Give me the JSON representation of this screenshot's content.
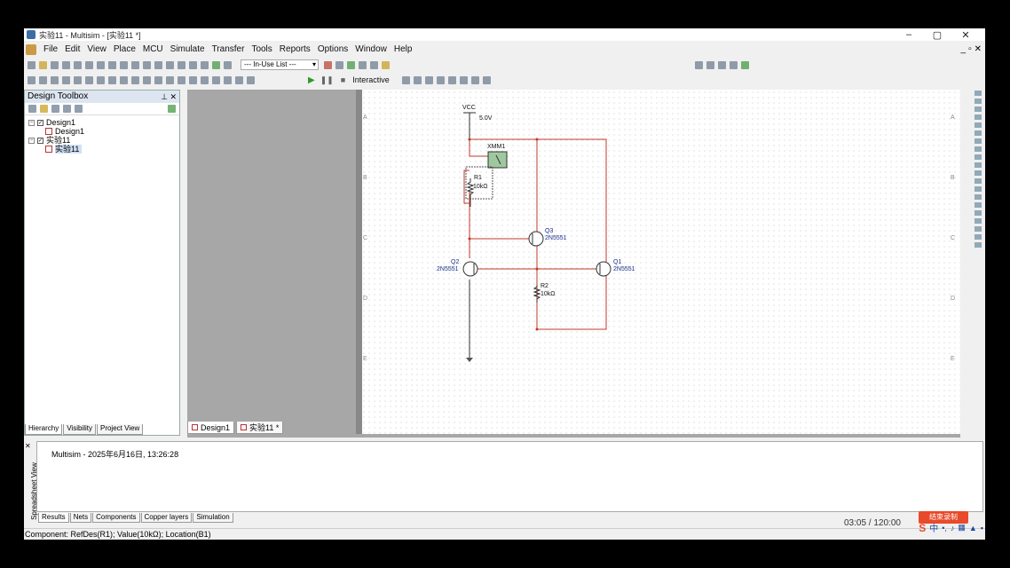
{
  "window": {
    "title": "实验11 - Multisim - [实验11 *]",
    "controls": [
      "–",
      "▢",
      "✕"
    ]
  },
  "menu": [
    "File",
    "Edit",
    "View",
    "Place",
    "MCU",
    "Simulate",
    "Transfer",
    "Tools",
    "Reports",
    "Options",
    "Window",
    "Help"
  ],
  "toolbar": {
    "in_use_list": "--- In-Use List ---",
    "interactive_label": "Interactive"
  },
  "toolbox": {
    "title": "Design Toolbox",
    "tree": [
      {
        "label": "Design1",
        "level": 0
      },
      {
        "label": "Design1",
        "level": 1
      },
      {
        "label": "实验11",
        "level": 0
      },
      {
        "label": "实验11",
        "level": 1
      }
    ],
    "tabs": [
      "Hierarchy",
      "Visibility",
      "Project View"
    ]
  },
  "schematic": {
    "vcc_label": "VCC",
    "vcc_value": "5.0V",
    "meter": "XMM1",
    "r1_name": "R1",
    "r1_value": "10kΩ",
    "r2_name": "R2",
    "r2_value": "10kΩ",
    "q1_name": "Q1",
    "q1_model": "2N5551",
    "q2_name": "Q2",
    "q2_model": "2N5551",
    "q3_name": "Q3",
    "q3_model": "2N5551",
    "zones": [
      "A",
      "B",
      "C",
      "D",
      "E"
    ]
  },
  "doc_tabs": [
    "Design1",
    "实验11 *"
  ],
  "output": {
    "message": "Multisim  -  2025年6月16日, 13:26:28",
    "side_label": "Spreadsheet View",
    "tabs": [
      "Results",
      "Nets",
      "Components",
      "Copper layers",
      "Simulation"
    ]
  },
  "status": "Component: RefDes(R1); Value(10kΩ); Location(B1)",
  "taskbar": {
    "time": "03:05 / 120:00",
    "record_label": "结束录制",
    "ime": "中"
  }
}
